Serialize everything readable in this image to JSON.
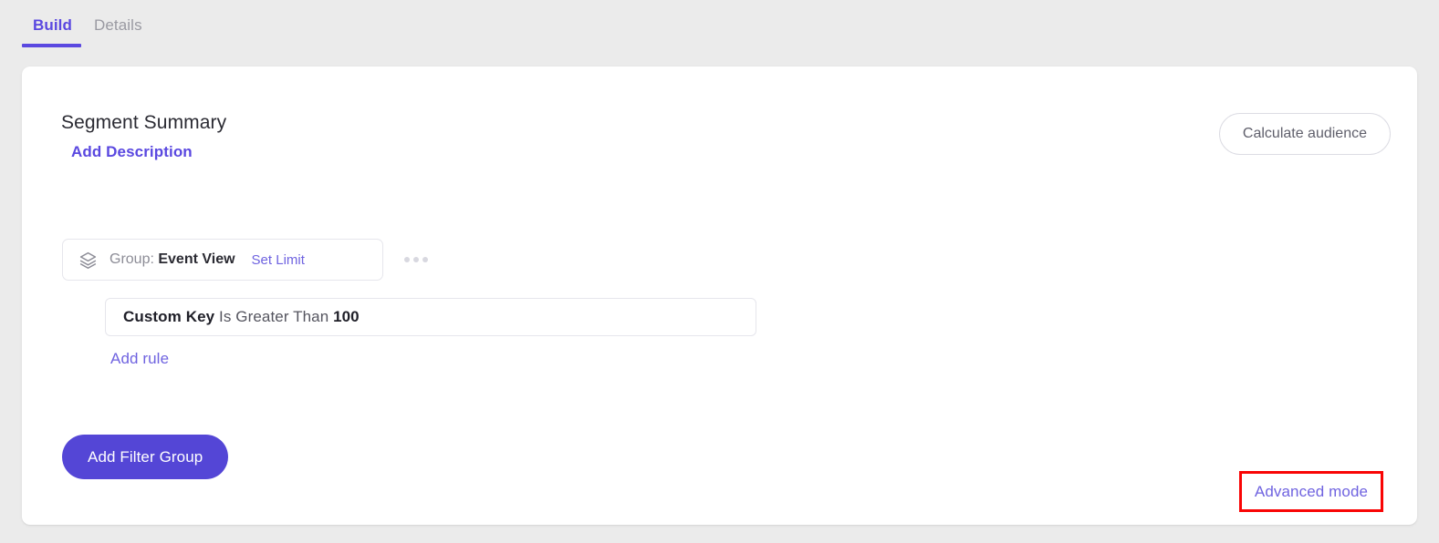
{
  "tabs": [
    {
      "label": "Build",
      "active": true
    },
    {
      "label": "Details",
      "active": false
    }
  ],
  "card": {
    "title": "Segment Summary",
    "add_description_label": "Add Description",
    "calculate_audience_label": "Calculate audience",
    "group": {
      "icon": "layers-icon",
      "prefix_label": "Group: ",
      "name": "Event View",
      "set_limit_label": "Set Limit",
      "overflow_icon": "ellipsis-icon"
    },
    "rule": {
      "attribute": "Custom Key",
      "operator": " Is Greater Than ",
      "value": "100"
    },
    "add_rule_label": "Add rule",
    "add_filter_group_label": "Add Filter Group",
    "advanced_mode_label": "Advanced mode"
  },
  "colors": {
    "accent": "#5a48e0",
    "button": "#5446d6",
    "link": "#6f63e0",
    "page_background": "#ebebeb",
    "card_background": "#ffffff",
    "highlight_border": "#f90505"
  }
}
